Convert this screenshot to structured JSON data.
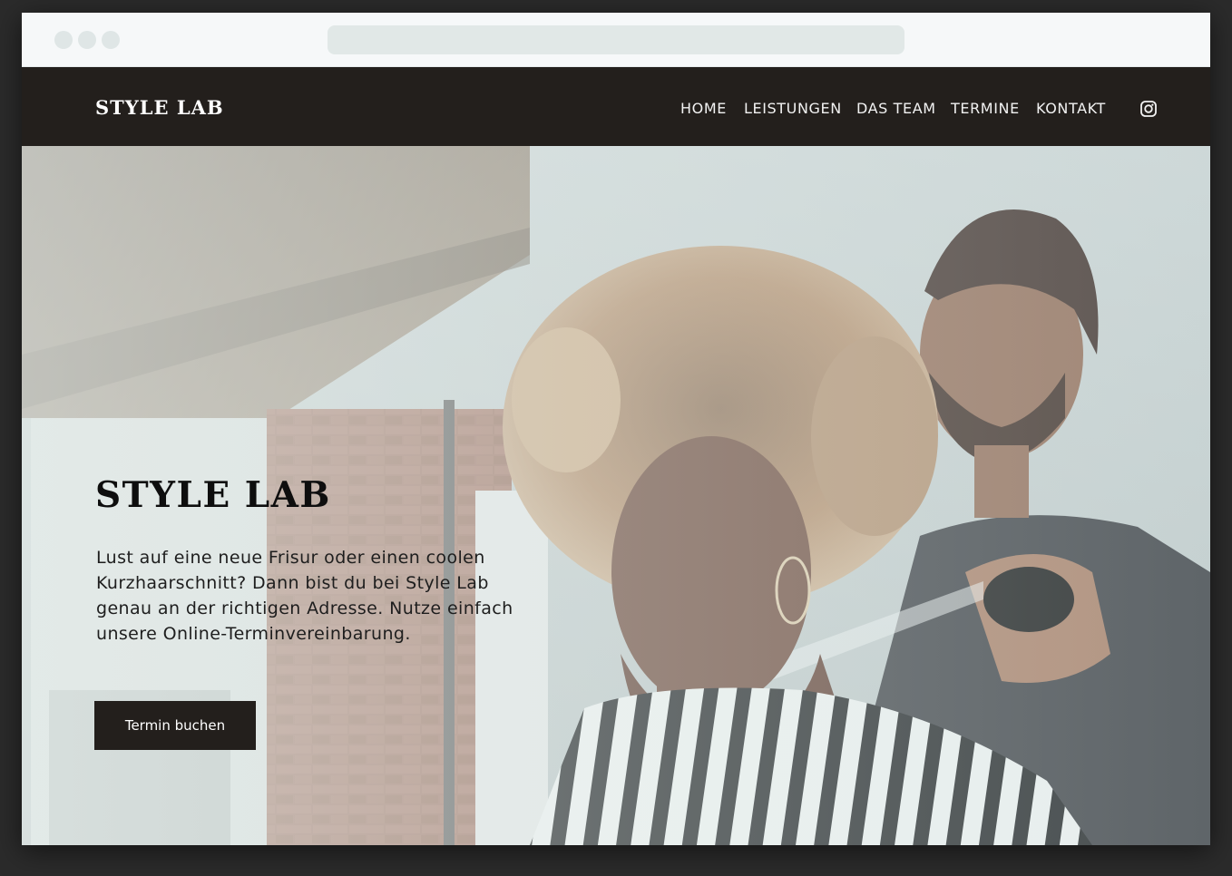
{
  "brand": {
    "logo_text": "STYLE LAB"
  },
  "nav": {
    "items": [
      {
        "label": "HOME"
      },
      {
        "label": "LEISTUNGEN"
      },
      {
        "label": "DAS TEAM"
      },
      {
        "label": "TERMINE"
      },
      {
        "label": "KONTAKT"
      }
    ],
    "social_icon": "instagram-icon"
  },
  "hero": {
    "title": "STYLE LAB",
    "text": "Lust auf eine neue Frisur oder einen coolen Kurzhaarschnitt? Dann bist du bei Style Lab genau an der richtigen Adresse. Nutze einfach unsere Online-Terminvereinbarung.",
    "cta_label": "Termin buchen"
  },
  "colors": {
    "navbar_bg": "#231f1c",
    "button_bg": "#231f1c",
    "nav_text": "#f2f2f2",
    "hero_wash": "#ebf2f0"
  }
}
